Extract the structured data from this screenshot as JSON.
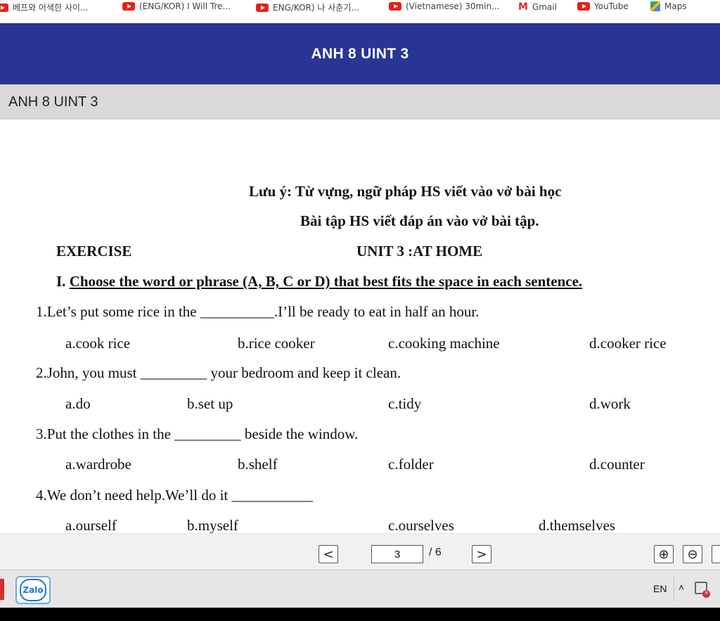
{
  "bookmarks": [
    {
      "label": "베프와 어색한 사이..."
    },
    {
      "label": "(ENG/KOR) I Will Tre..."
    },
    {
      "label": "ENG/KOR) 나 사춘기..."
    },
    {
      "label": "(Vietnamese) 30min..."
    },
    {
      "label": "Gmail"
    },
    {
      "label": "YouTube"
    },
    {
      "label": "Maps"
    }
  ],
  "header": {
    "title": "ANH 8 UINT 3",
    "subtitle": "ANH 8 UINT 3"
  },
  "document": {
    "note1": "Lưu ý: Từ vựng, ngữ pháp HS viết vào vở bài học",
    "note2": "Bài tập HS viết đáp án vào vở bài tập.",
    "exercise_label": "EXERCISE",
    "unit_label": "UNIT 3 :AT HOME",
    "section_number": "I.",
    "section_title": "Choose the word or phrase (A, B, C or D) that best fits the space in each sentence.",
    "questions": [
      {
        "text": "1.Let’s put some rice in the __________.I’ll be ready to eat in half an hour.",
        "options": [
          "a.cook rice",
          "b.rice cooker",
          "c.cooking machine",
          "d.cooker rice"
        ]
      },
      {
        "text": "2.John, you must _________ your bedroom and keep it clean.",
        "options": [
          "a.do",
          "b.set up",
          "c.tidy",
          "d.work"
        ]
      },
      {
        "text": "3.Put the clothes in the _________ beside the window.",
        "options": [
          "a.wardrobe",
          "b.shelf",
          "c.folder",
          "d.counter"
        ]
      },
      {
        "text": "4.We don’t need help.We’ll do it ___________",
        "options": [
          "a.ourself",
          "b.myself",
          "c.ourselves",
          "d.themselves"
        ]
      }
    ]
  },
  "pager": {
    "prev": "<",
    "page": "3",
    "total": "/ 6",
    "next": ">",
    "zoom_in": "⊕",
    "zoom_out": "⊖"
  },
  "taskbar": {
    "zalo_label": "Zalo",
    "lang": "EN",
    "tray_up": "˄"
  }
}
